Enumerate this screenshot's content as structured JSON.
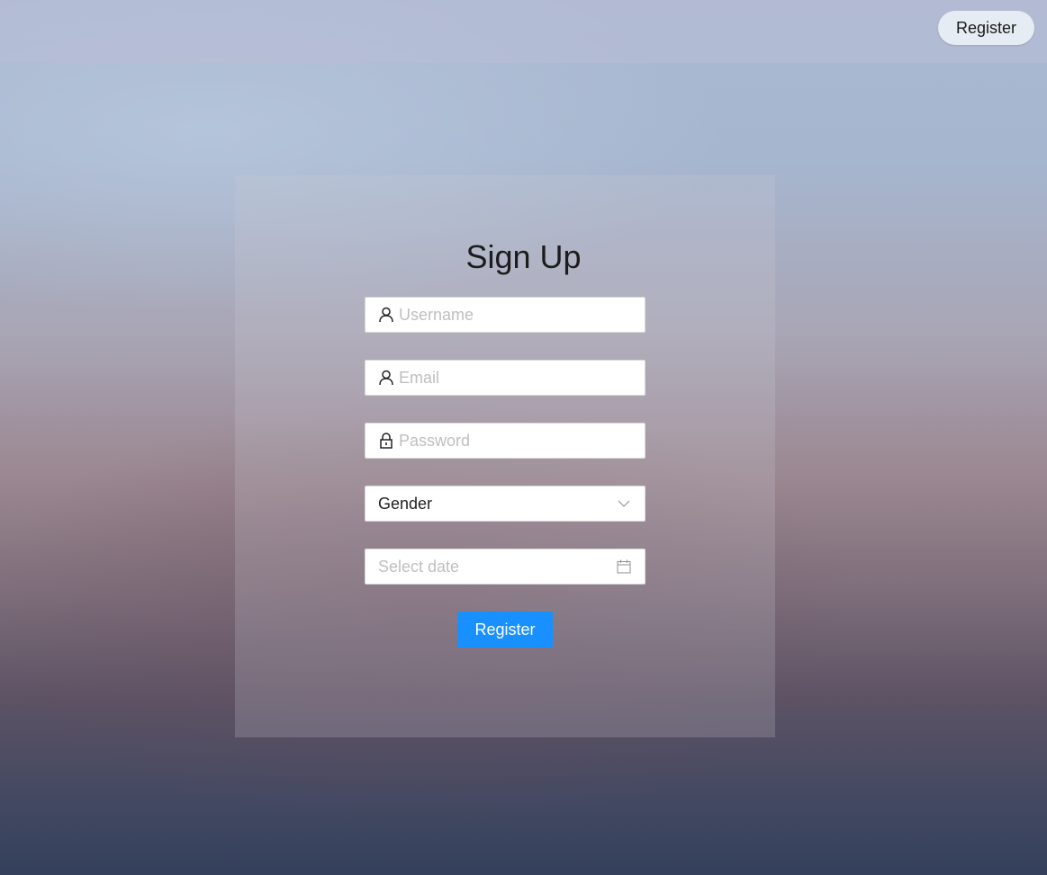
{
  "header": {
    "register_label": "Register"
  },
  "form": {
    "title": "Sign Up",
    "username": {
      "placeholder": "Username",
      "icon": "user-icon"
    },
    "email": {
      "placeholder": "Email",
      "icon": "user-icon"
    },
    "password": {
      "placeholder": "Password",
      "icon": "lock-icon"
    },
    "gender": {
      "value": "Gender",
      "icon": "chevron-down-icon"
    },
    "date": {
      "placeholder": "Select date",
      "icon": "calendar-icon"
    },
    "submit_label": "Register"
  },
  "colors": {
    "primary": "#1890ff",
    "placeholder": "#bfbfbf",
    "title": "#1c1c1c"
  }
}
